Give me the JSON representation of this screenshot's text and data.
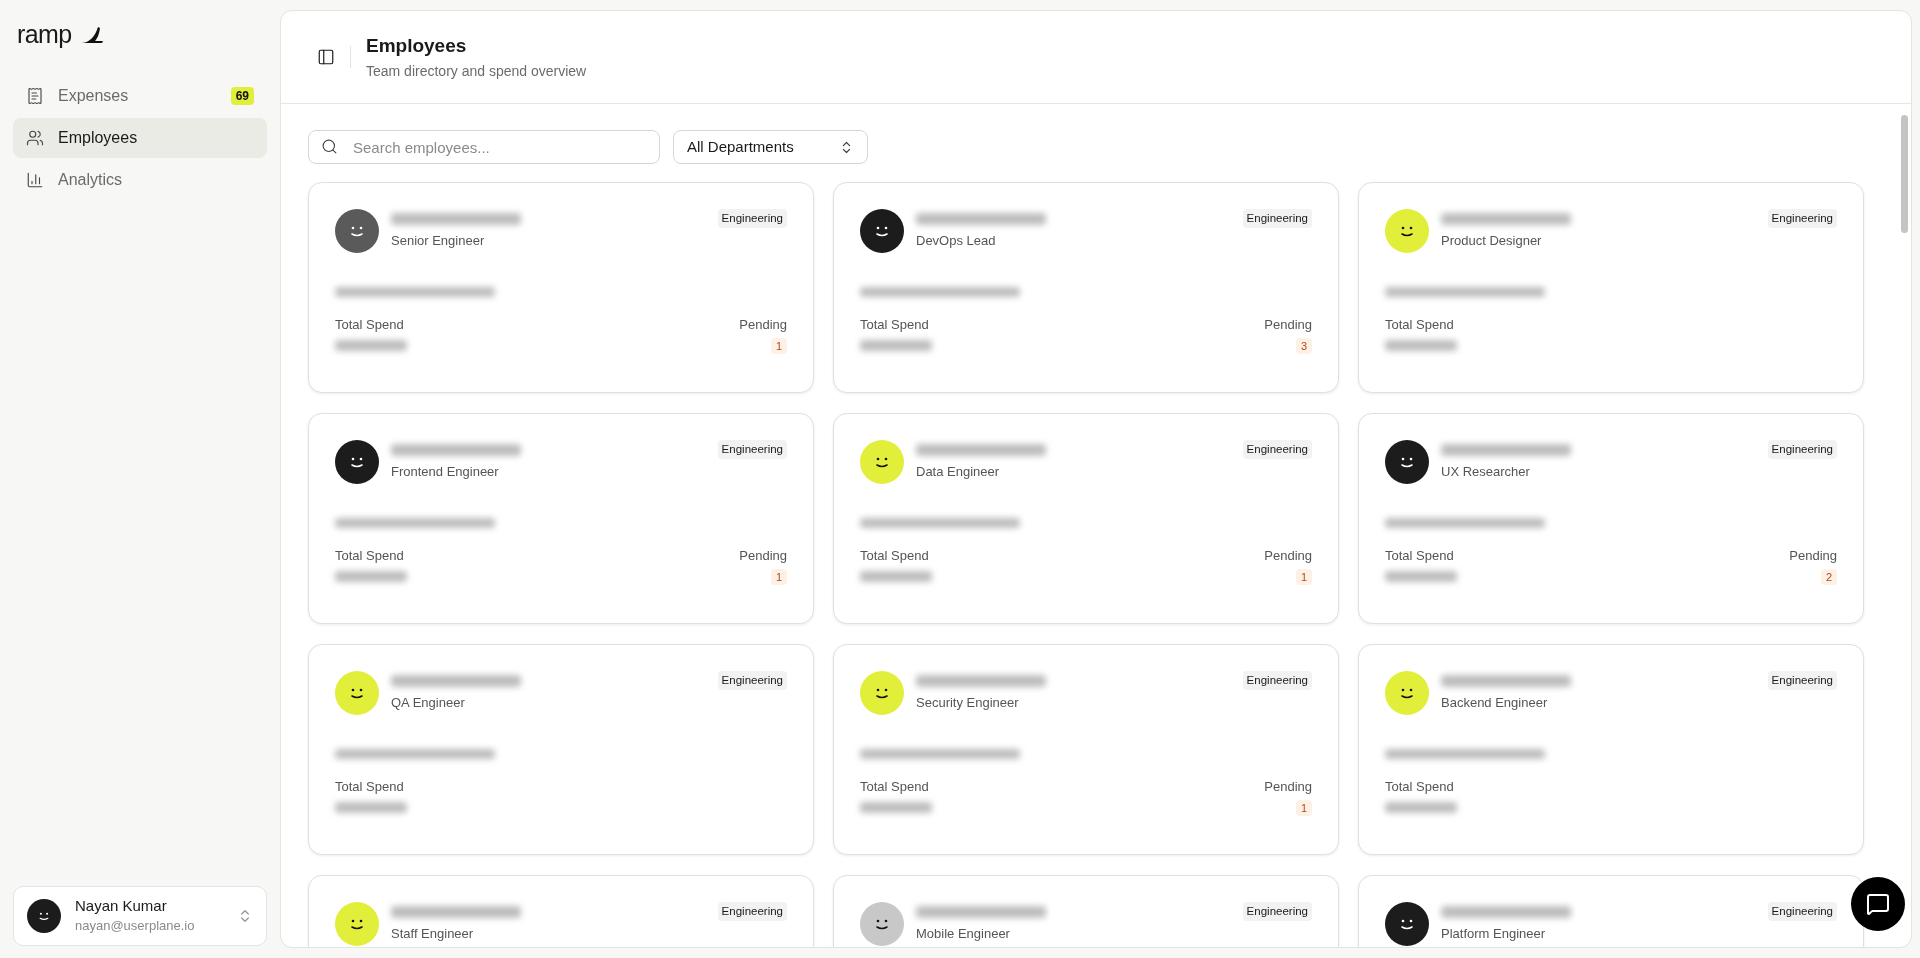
{
  "brand": "ramp",
  "nav": [
    {
      "label": "Expenses",
      "badge": "69",
      "selected": false
    },
    {
      "label": "Employees",
      "selected": true
    },
    {
      "label": "Analytics",
      "selected": false
    }
  ],
  "user": {
    "name": "Nayan Kumar",
    "email": "nayan@userplane.io"
  },
  "header": {
    "title": "Employees",
    "subtitle": "Team directory and spend overview"
  },
  "search": {
    "placeholder": "Search employees..."
  },
  "department_filter": {
    "value": "All Departments"
  },
  "employees": [
    {
      "role": "Senior Engineer",
      "department": "Engineering",
      "color": "#5a5a5a",
      "total_label": "Total Spend",
      "pending_label": "Pending",
      "pending": "1"
    },
    {
      "role": "DevOps Lead",
      "department": "Engineering",
      "color": "#1c1c1c",
      "total_label": "Total Spend",
      "pending_label": "Pending",
      "pending": "3"
    },
    {
      "role": "Product Designer",
      "department": "Engineering",
      "color": "#e2ef3a",
      "total_label": "Total Spend"
    },
    {
      "role": "Frontend Engineer",
      "department": "Engineering",
      "color": "#1c1c1c",
      "total_label": "Total Spend",
      "pending_label": "Pending",
      "pending": "1"
    },
    {
      "role": "Data Engineer",
      "department": "Engineering",
      "color": "#e2ef3a",
      "total_label": "Total Spend",
      "pending_label": "Pending",
      "pending": "1"
    },
    {
      "role": "UX Researcher",
      "department": "Engineering",
      "color": "#1c1c1c",
      "total_label": "Total Spend",
      "pending_label": "Pending",
      "pending": "2"
    },
    {
      "role": "QA Engineer",
      "department": "Engineering",
      "color": "#e2ef3a",
      "total_label": "Total Spend"
    },
    {
      "role": "Security Engineer",
      "department": "Engineering",
      "color": "#e2ef3a",
      "total_label": "Total Spend",
      "pending_label": "Pending",
      "pending": "1"
    },
    {
      "role": "Backend Engineer",
      "department": "Engineering",
      "color": "#e2ef3a",
      "total_label": "Total Spend"
    },
    {
      "role": "Staff Engineer",
      "department": "Engineering",
      "color": "#e2ef3a"
    },
    {
      "role": "Mobile Engineer",
      "department": "Engineering",
      "color": "#c8c8c8"
    },
    {
      "role": "Platform Engineer",
      "department": "Engineering",
      "color": "#1c1c1c"
    }
  ]
}
